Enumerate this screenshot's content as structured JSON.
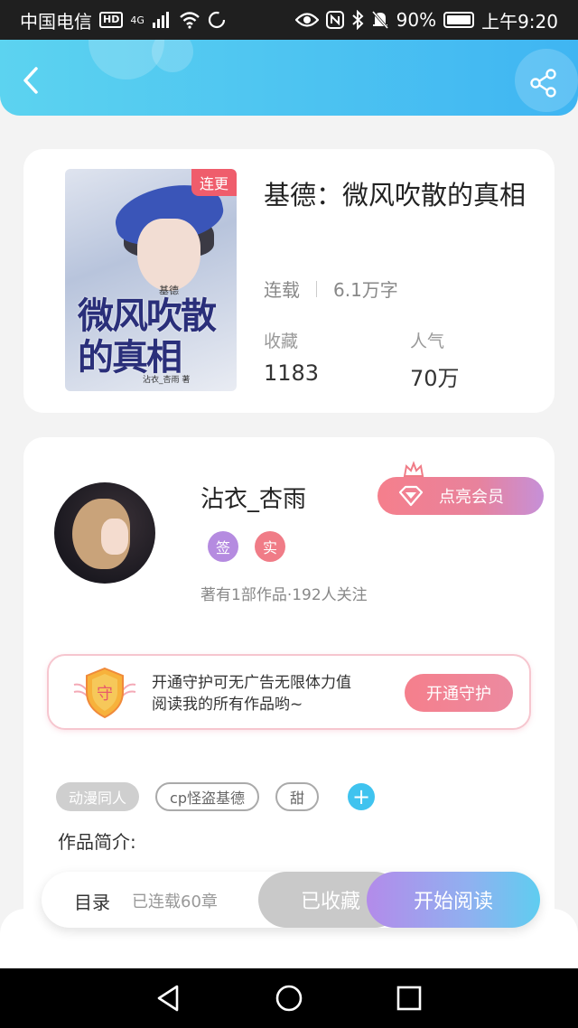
{
  "status_bar": {
    "carrier": "中国电信",
    "hd": "HD",
    "network": "4G",
    "battery": "90%",
    "time": "上午9:20"
  },
  "header": {
    "back_icon": "back-arrow-icon",
    "share_icon": "share-icon"
  },
  "book": {
    "cover_badge": "连更",
    "cover_title": "微风吹散的真相",
    "cover_subtitle": "基德",
    "cover_author": "沾衣_杏雨 著",
    "title": "基德：微风吹散的真相",
    "status": "连载",
    "word_count": "6.1万字",
    "stats": [
      {
        "label": "收藏",
        "value": "1183"
      },
      {
        "label": "人气",
        "value": "70万"
      }
    ]
  },
  "author": {
    "name": "沾衣_杏雨",
    "badges": [
      {
        "text": "签",
        "color": "#b58be0"
      },
      {
        "text": "实",
        "color": "#f07c87"
      }
    ],
    "info": "著有1部作品·192人关注",
    "vip_button": "点亮会员",
    "guard": {
      "shield_text": "守",
      "line1": "开通守护可无广告无限体力值",
      "line2": "阅读我的所有作品哟~",
      "button": "开通守护"
    }
  },
  "tags": [
    "动漫同人",
    "cp怪盗基德",
    "甜"
  ],
  "intro_label": "作品简介:",
  "bottom_bar": {
    "catalog": "目录",
    "chapters": "已连载60章",
    "collected": "已收藏",
    "start_reading": "开始阅读"
  },
  "colors": {
    "accent_blue": "#3fb5f2",
    "accent_pink": "#f57f8c",
    "accent_purple": "#b38bea"
  }
}
